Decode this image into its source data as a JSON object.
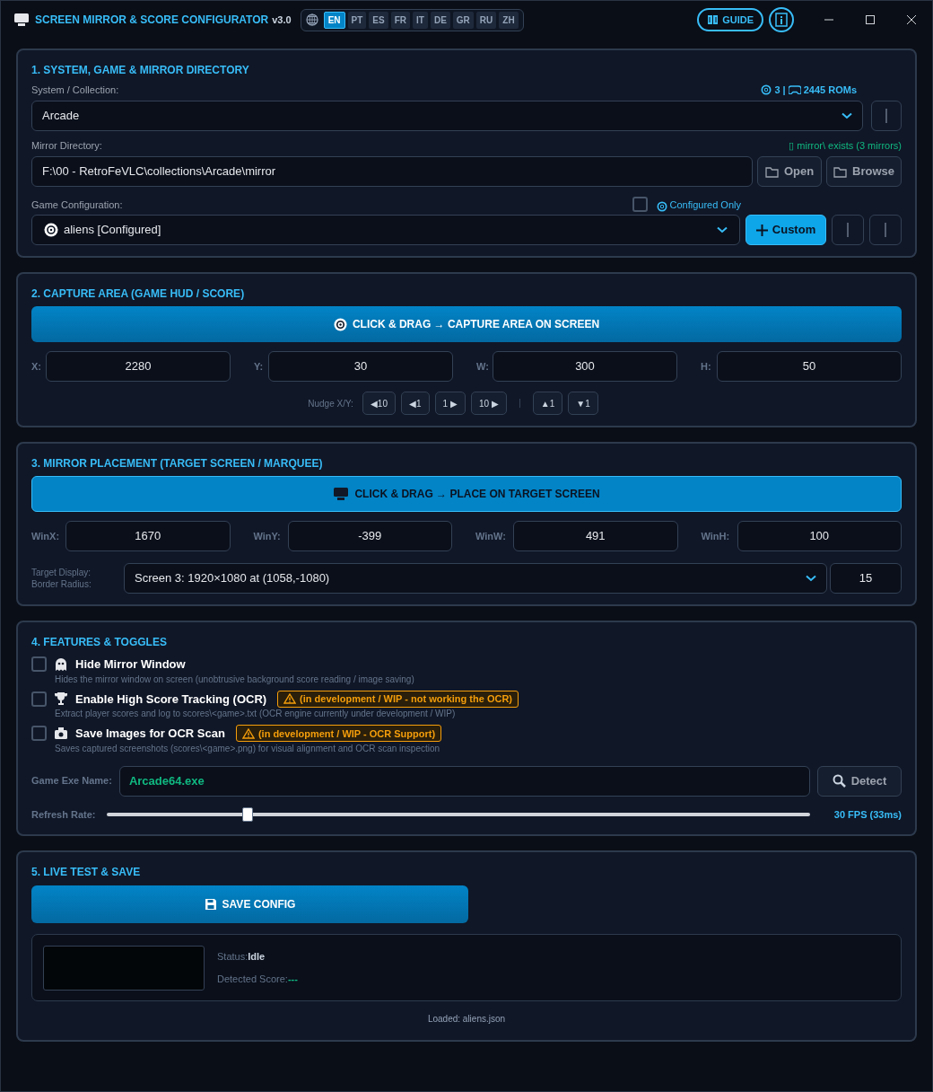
{
  "window": {
    "title": "SCREEN MIRROR & SCORE CONFIGURATOR",
    "version": "v3.0",
    "guide": "GUIDE"
  },
  "languages": [
    {
      "label": "EN",
      "selected": true
    },
    {
      "label": "PT",
      "selected": false
    },
    {
      "label": "ES",
      "selected": false
    },
    {
      "label": "FR",
      "selected": false
    },
    {
      "label": "IT",
      "selected": false
    },
    {
      "label": "DE",
      "selected": false
    },
    {
      "label": "GR",
      "selected": false
    },
    {
      "label": "RU",
      "selected": false
    },
    {
      "label": "ZH",
      "selected": false
    }
  ],
  "section_1": {
    "heading": "1. SYSTEM, GAME & MIRROR DIRECTORY",
    "system_label": "System / Collection:",
    "configured_count": "3 |",
    "rom_count": "2445 ROMs",
    "system": "Arcade",
    "mirror_label": "Mirror Directory:",
    "mirror_status": "▯ mirror\\ exists (3 mirrors)",
    "mirror_path": "F:\\00 - RetroFeVLC\\collections\\Arcade\\mirror",
    "open": "Open",
    "browse": "Browse",
    "game_label": "Game Configuration:",
    "configured_only": {
      "label": "Configured Only",
      "checked": false
    },
    "game": "aliens [Configured]",
    "custom": "Custom"
  },
  "section_2": {
    "heading": "2. CAPTURE AREA (GAME HUD / SCORE)",
    "capture_button": "CLICK & DRAG → CAPTURE AREA ON SCREEN",
    "fields": [
      {
        "label": "X:",
        "value": "2280"
      },
      {
        "label": "Y:",
        "value": "30"
      },
      {
        "label": "W:",
        "value": "300"
      },
      {
        "label": "H:",
        "value": "50"
      }
    ],
    "nudge_label": "Nudge X/Y:",
    "nudge_x": [
      "◀10",
      "◀1",
      "1 ▶",
      "10 ▶"
    ],
    "nudge_y": [
      "▲1",
      "▼1"
    ]
  },
  "section_3": {
    "heading": "3. MIRROR PLACEMENT (TARGET SCREEN / MARQUEE)",
    "place_button": "CLICK & DRAG → PLACE ON TARGET SCREEN",
    "fields": [
      {
        "label": "WinX:",
        "value": "1670"
      },
      {
        "label": "WinY:",
        "value": "-399"
      },
      {
        "label": "WinW:",
        "value": "491"
      },
      {
        "label": "WinH:",
        "value": "100"
      }
    ],
    "display_label": "Target Display:",
    "radius_label": "Border Radius:",
    "display": "Screen 3: 1920×1080 at (1058,-1080)",
    "radius": "15"
  },
  "section_4": {
    "heading": "4. FEATURES & TOGGLES",
    "toggles": [
      {
        "kind": "ghost",
        "label": "Hide Mirror Window",
        "description": "Hides the mirror window on screen (unobtrusive background score reading / image saving)",
        "checked": false
      },
      {
        "kind": "trophy",
        "label": "Enable High Score Tracking (OCR)",
        "warning": "(in development / WIP - not working the OCR)",
        "description": "Extract player scores and log to scores\\<game>.txt (OCR engine currently under development / WIP)",
        "checked": false
      },
      {
        "kind": "camera",
        "label": "Save Images for OCR Scan",
        "warning": "(in development / WIP - OCR Support)",
        "description": "Saves captured screenshots (scores\\<game>.png) for visual alignment and OCR scan inspection",
        "checked": false
      }
    ],
    "exe_label": "Game Exe Name:",
    "exe": "Arcade64.exe",
    "detect": "Detect",
    "refresh_label": "Refresh Rate:",
    "refresh": {
      "level": 0.2
    },
    "refresh_reading": "30 FPS (33ms)"
  },
  "section_5": {
    "heading": "5. LIVE TEST & SAVE",
    "save": "SAVE CONFIG",
    "status_label": "Status:",
    "status": "Idle",
    "score_label": "Detected Score:",
    "score": "---",
    "loaded": "Loaded: aliens.json"
  }
}
